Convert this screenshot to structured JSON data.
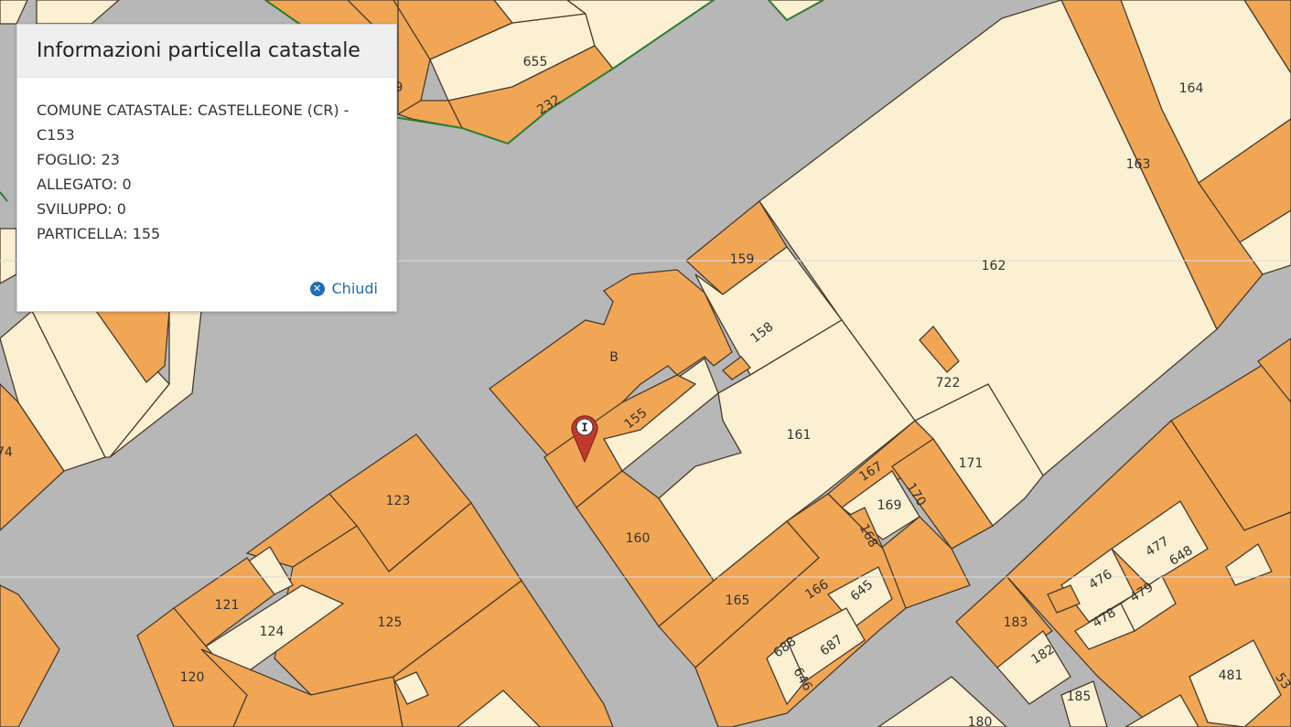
{
  "popup": {
    "title": "Informazioni particella catastale",
    "lines": [
      "COMUNE CATASTALE: CASTELLEONE (CR) - C153",
      "FOGLIO: 23",
      "ALLEGATO: 0",
      "SVILUPPO: 0",
      "PARTICELLA: 155"
    ],
    "close_label": "Chiudi",
    "close_icon": "close-circle-icon"
  },
  "marker": {
    "icon": "info-pin-icon",
    "letter": "I",
    "color": "#c0392b"
  },
  "colors": {
    "road": "#b7b7b7",
    "building": "#f0a655",
    "yard": "#fcf0d2",
    "boundary": "#4a3a2a",
    "green_line": "#2e7d32",
    "link": "#1f6db5"
  },
  "parcels": [
    "655",
    "232",
    "164",
    "163",
    "162",
    "159",
    "158",
    "B",
    "722",
    "155",
    "161",
    "171",
    "167",
    "169",
    "170",
    "168",
    "123",
    "160",
    "477",
    "648",
    "476",
    "479",
    "478",
    "121",
    "124",
    "125",
    "165",
    "166",
    "645",
    "183",
    "688",
    "687",
    "646",
    "182",
    "120",
    "481",
    "185",
    "180",
    "9",
    "74",
    "53"
  ]
}
